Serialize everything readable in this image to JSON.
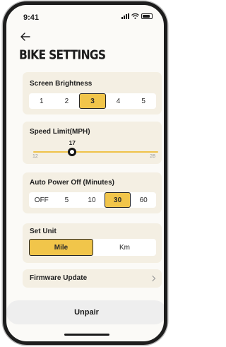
{
  "status_bar": {
    "time": "9:41"
  },
  "header": {
    "title": "BIKE SETTINGS"
  },
  "screen_brightness": {
    "label": "Screen Brightness",
    "options": [
      "1",
      "2",
      "3",
      "4",
      "5"
    ],
    "selected": "3"
  },
  "speed_limit": {
    "label": "Speed Limit(MPH)",
    "value": "17",
    "min": "12",
    "max": "28"
  },
  "auto_power_off": {
    "label": "Auto Power Off (Minutes)",
    "options": [
      "OFF",
      "5",
      "10",
      "30",
      "60"
    ],
    "selected": "30"
  },
  "set_unit": {
    "label": "Set Unit",
    "options": [
      "Mile",
      "Km"
    ],
    "selected": "Mile"
  },
  "firmware": {
    "label": "Firmware Update"
  },
  "unpair": {
    "label": "Unpair"
  },
  "colors": {
    "accent": "#f1c54a",
    "card_background": "#f4efe3",
    "button_background": "#eeeeee"
  }
}
